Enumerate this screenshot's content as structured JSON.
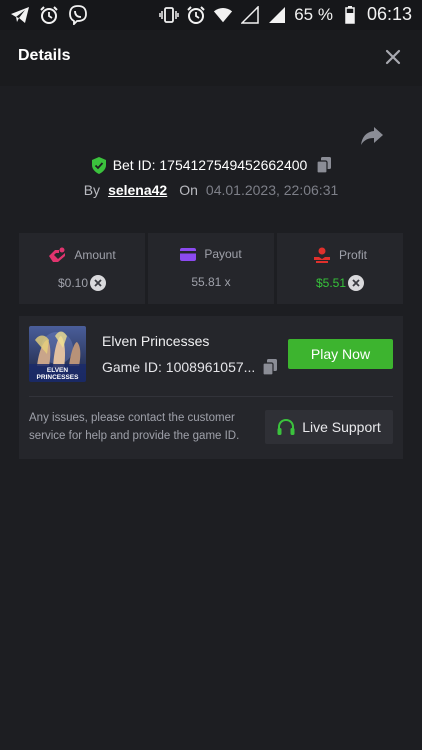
{
  "status_bar": {
    "left_icons": [
      "telegram-icon",
      "alarm-icon",
      "viber-icon"
    ],
    "right_icons": [
      "vibrate-icon",
      "alarm-icon",
      "wifi-icon",
      "signal-empty-icon",
      "signal-icon"
    ],
    "battery_text": "65 %",
    "time": "06:13"
  },
  "header": {
    "title": "Details"
  },
  "bet": {
    "id_label": "Bet ID: 1754127549452662400",
    "by_label": "By",
    "username": "selena42",
    "on_label": "On",
    "date": "04.01.2023, 22:06:31"
  },
  "stats": {
    "amount": {
      "label": "Amount",
      "value": "$0.10",
      "icon": "amount-icon"
    },
    "payout": {
      "label": "Payout",
      "value": "55.81 x",
      "icon": "card-icon"
    },
    "profit": {
      "label": "Profit",
      "value": "$5.51",
      "icon": "profit-icon"
    }
  },
  "game": {
    "thumbnail_text": "ELVEN PRINCESSES",
    "name": "Elven Princesses",
    "id_label": "Game ID: 1008961057...",
    "play_label": "Play Now",
    "help_text": "Any issues, please contact the customer service for help and provide the game ID.",
    "support_label": "Live Support"
  },
  "colors": {
    "background": "#1d1e22",
    "card": "#25262b",
    "accent_green": "#3db42f",
    "profit_green": "#36c23a",
    "amount_pink": "#e0346e",
    "payout_purple": "#8c4af0",
    "profit_red": "#e0302c"
  }
}
